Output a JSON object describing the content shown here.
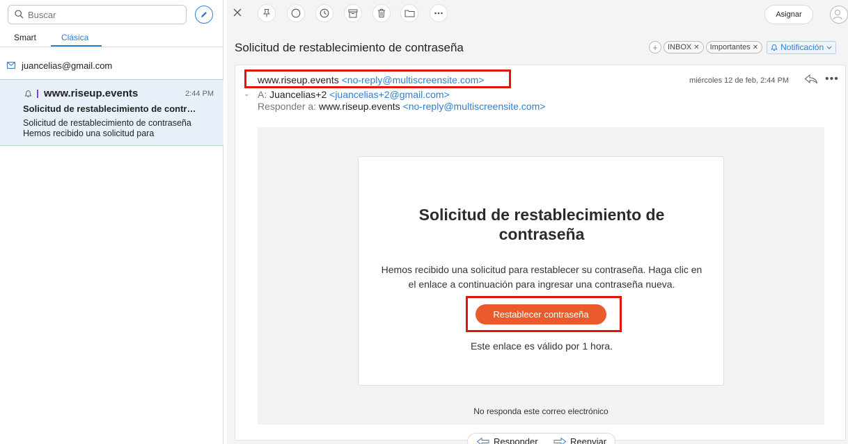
{
  "sidebar": {
    "search_placeholder": "Buscar",
    "compose_icon": "pencil-icon",
    "tabs": [
      {
        "label": "Smart",
        "active": false
      },
      {
        "label": "Clásica",
        "active": true
      }
    ],
    "account_email": "juancelias@gmail.com",
    "messages": [
      {
        "from": "www.riseup.events",
        "time": "2:44 PM",
        "subject": "Solicitud de restablecimiento de contr…",
        "preview_line1": "Solicitud de restablecimiento de contraseña",
        "preview_line2": "Hemos recibido una solicitud para"
      }
    ]
  },
  "toolbar": {
    "icons": [
      "close-icon",
      "pin-icon",
      "circle-icon",
      "clock-icon",
      "archive-icon",
      "trash-icon",
      "folder-icon",
      "more-icon"
    ],
    "assign_label": "Asignar"
  },
  "email": {
    "title": "Solicitud de restablecimiento de contraseña",
    "tags": [
      "INBOX",
      "Importantes"
    ],
    "notification_label": "Notificación",
    "from_name": "www.riseup.events",
    "from_email": "<no-reply@multiscreensite.com>",
    "date": "miércoles 12 de feb, 2:44 PM",
    "to_label": "A:",
    "to_name": "Juancelias+2",
    "to_email": "<juancelias+2@gmail.com>",
    "reply_label": "Responder a:",
    "reply_name": "www.riseup.events",
    "reply_email": "<no-reply@multiscreensite.com>",
    "body": {
      "heading_line1": "Solicitud de restablecimiento de",
      "heading_line2": "contraseña",
      "message_line1": "Hemos recibido una solicitud para restablecer su contraseña. Haga clic en",
      "message_line2": "el enlace a continuación para ingresar una contraseña nueva.",
      "button_label": "Restablecer contraseña",
      "validity": "Este enlace es válido por 1 hora.",
      "footer": "No responda este correo electrónico"
    }
  },
  "actions": {
    "reply_label": "Responder",
    "forward_label": "Reenviar"
  },
  "colors": {
    "accent": "#2f7fd1",
    "button": "#ea5a2d",
    "highlight_box": "#e3160b"
  }
}
